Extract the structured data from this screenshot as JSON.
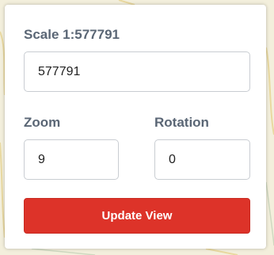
{
  "scale": {
    "label": "Scale 1:577791",
    "value": "577791"
  },
  "zoom": {
    "label": "Zoom",
    "value": "9"
  },
  "rotation": {
    "label": "Rotation",
    "value": "0"
  },
  "actions": {
    "update_label": "Update View"
  },
  "colors": {
    "button_bg": "#dd3329",
    "label_text": "#5a6675",
    "map_bg": "#f3efdc"
  }
}
